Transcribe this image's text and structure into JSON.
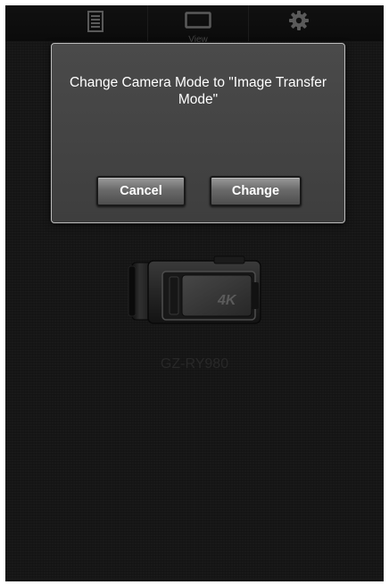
{
  "toolbar": {
    "items": [
      {
        "icon": "list-icon",
        "label": ""
      },
      {
        "icon": "view-icon",
        "label": "View"
      },
      {
        "icon": "settings-icon",
        "label": ""
      }
    ]
  },
  "dialog": {
    "message": "Change Camera Mode to \"Image Transfer Mode\"",
    "cancel_label": "Cancel",
    "change_label": "Change"
  },
  "camera": {
    "icon": "camcorder-icon",
    "badge": "4K",
    "model": "GZ-RY980"
  }
}
